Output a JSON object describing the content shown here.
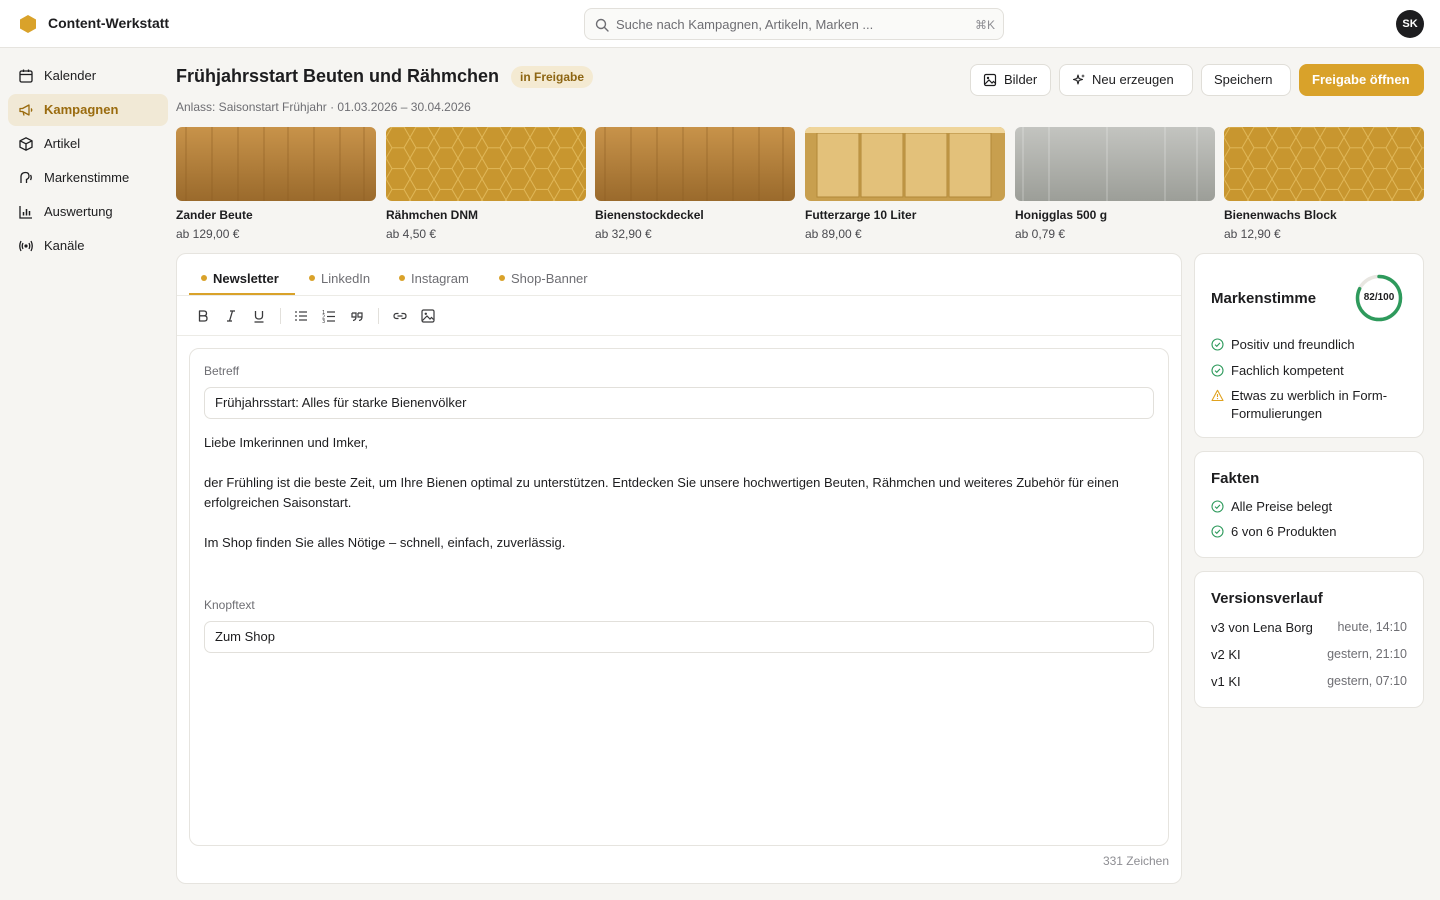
{
  "app": {
    "title": "Content-Werkstatt",
    "user_initials": "SK"
  },
  "search": {
    "placeholder": "Suche nach Kampagnen, Artikeln, Marken ...",
    "shortcut": "⌘K"
  },
  "sidebar": {
    "items": [
      {
        "label": "Kalender",
        "icon": "calendar-icon"
      },
      {
        "label": "Kampagnen",
        "icon": "megaphone-icon",
        "active": true
      },
      {
        "label": "Artikel",
        "icon": "box-icon"
      },
      {
        "label": "Markenstimme",
        "icon": "voice-icon"
      },
      {
        "label": "Auswertung",
        "icon": "bar-chart-icon"
      },
      {
        "label": "Kanäle",
        "icon": "broadcast-icon"
      }
    ]
  },
  "campaign": {
    "title": "Frühjahrsstart Beuten und Rähmchen",
    "status": "in Freigabe",
    "subtitle": "Anlass: Saisonstart Frühjahr · 01.03.2026 – 30.04.2026"
  },
  "actions": {
    "images": "Bilder",
    "regenerate": "Neu erzeugen",
    "save": "Speichern",
    "open_approval": "Freigabe öffnen"
  },
  "products": [
    {
      "name": "Zander Beute",
      "price": "ab 129,00 €"
    },
    {
      "name": "Rähmchen DNM",
      "price": "ab 4,50 €"
    },
    {
      "name": "Bienenstockdeckel",
      "price": "ab 32,90 €"
    },
    {
      "name": "Futterzarge 10 Liter",
      "price": "ab 89,00 €"
    },
    {
      "name": "Honigglas 500 g",
      "price": "ab 0,79 €"
    },
    {
      "name": "Bienenwachs Block",
      "price": "ab 12,90 €"
    }
  ],
  "tabs": [
    {
      "label": "Newsletter",
      "active": true
    },
    {
      "label": "LinkedIn"
    },
    {
      "label": "Instagram"
    },
    {
      "label": "Shop-Banner"
    }
  ],
  "newsletter": {
    "subject_label": "Betreff",
    "subject": "Frühjahrsstart: Alles für starke Bienenvölker",
    "greeting": "Liebe Imkerinnen und Imker,",
    "paragraph1": "der Frühling ist die beste Zeit, um Ihre Bienen optimal zu unterstützen. Entdecken Sie unsere hochwertigen Beuten, Rähmchen und weiteres Zubehör für einen erfolgreichen Saisonstart.",
    "paragraph2": "Im Shop finden Sie alles Nötige – schnell, einfach, zuverlässig.",
    "button_label": "Knopftext",
    "button_text": "Zum Shop",
    "char_count": "331 Zeichen"
  },
  "brand_voice": {
    "title": "Markenstimme",
    "score_text": "82/100",
    "score": 82,
    "checks": [
      {
        "label": "Positiv und freundlich",
        "status": "ok"
      },
      {
        "label": "Fachlich kompetent",
        "status": "ok"
      },
      {
        "label": "Etwas zu werblich in Form-Formulierungen",
        "status": "warning"
      }
    ]
  },
  "facts": {
    "title": "Fakten",
    "checks": [
      {
        "label": "Alle Preise belegt",
        "status": "ok"
      },
      {
        "label": "6 von 6 Produkten",
        "status": "ok"
      }
    ]
  },
  "versions": {
    "title": "Versionsverlauf",
    "items": [
      {
        "label": "v3 von Lena Borg",
        "time": "heute, 14:10"
      },
      {
        "label": "v2 KI",
        "time": "gestern, 21:10"
      },
      {
        "label": "v1 KI",
        "time": "gestern, 07:10"
      }
    ]
  },
  "colors": {
    "accent": "#d9a22a",
    "success": "#2e9a5c",
    "warning": "#e0a21f"
  }
}
